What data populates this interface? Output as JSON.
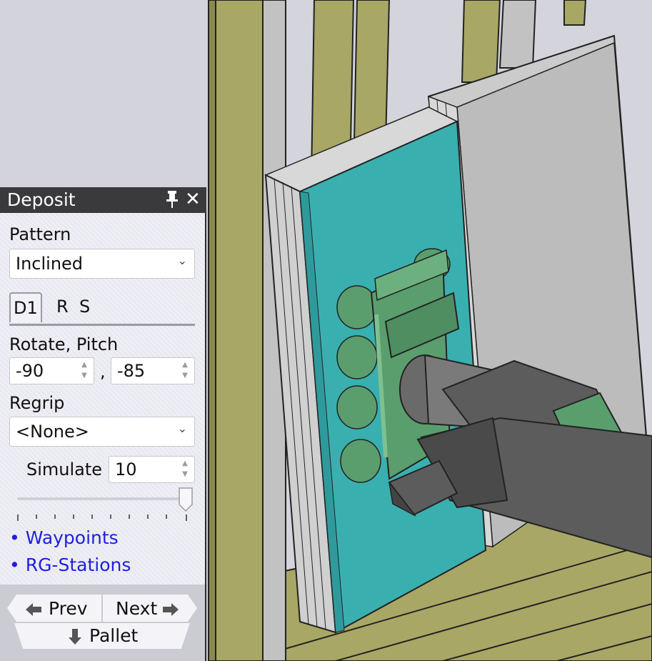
{
  "panel": {
    "title": "Deposit",
    "pin_icon": "pin-icon",
    "close_icon": "close-icon",
    "pattern_label": "Pattern",
    "pattern_value": "Inclined",
    "tabs": [
      {
        "label": "D1",
        "active": true
      },
      {
        "label": "R",
        "active": false
      },
      {
        "label": "S",
        "active": false
      }
    ],
    "rotate_pitch_label": "Rotate, Pitch",
    "rotate_value": "-90",
    "separator": ",",
    "pitch_value": "-85",
    "regrip_label": "Regrip",
    "regrip_value": "<None>",
    "simulate_label": "Simulate",
    "simulate_value": "10",
    "slider_level": 1.0,
    "links": {
      "waypoints": "• Waypoints",
      "rg_stations": "• RG-Stations"
    },
    "nav": {
      "prev": "Prev",
      "next": "Next",
      "pallet": "Pallet"
    }
  },
  "colors": {
    "frame_wood": "#a8a765",
    "panel_teal": "#3aafb0",
    "panel_grey": "#cbcbcb",
    "gripper_green": "#5a9e6e",
    "robot_arm": "#5c5c5c",
    "background": "#d3d3dc",
    "link_blue": "#1f1fe0"
  }
}
